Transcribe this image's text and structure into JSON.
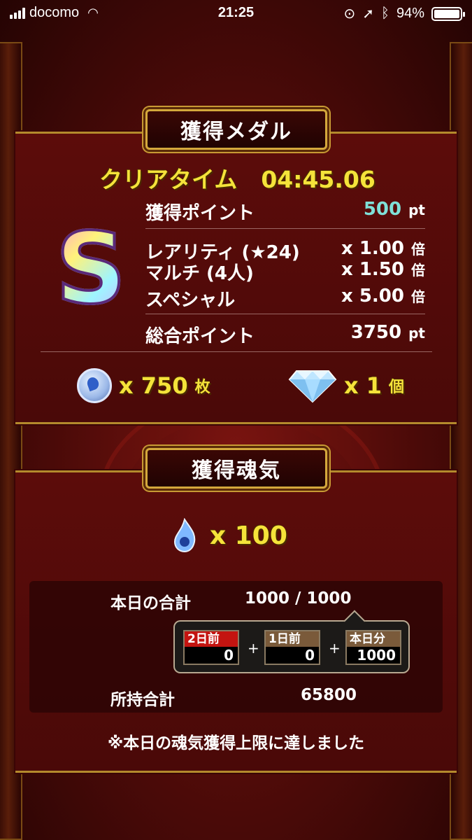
{
  "status_bar": {
    "carrier": "docomo",
    "time": "21:25",
    "battery": "94%"
  },
  "medal_panel": {
    "title": "獲得メダル",
    "clear_time_label": "クリアタイム",
    "clear_time_value": "04:45.06",
    "rank": "S",
    "earned_points_label": "獲得ポイント",
    "earned_points_value": "500",
    "pt_unit": "pt",
    "multipliers": [
      {
        "label": "レアリティ (★24)",
        "value": "x 1.00",
        "unit": "倍"
      },
      {
        "label": "マルチ (4人)",
        "value": "x 1.50",
        "unit": "倍"
      },
      {
        "label": "スペシャル",
        "value": "x 5.00",
        "unit": "倍"
      }
    ],
    "total_points_label": "総合ポイント",
    "total_points_value": "3750",
    "medal_reward": "x 750",
    "medal_unit": "枚",
    "gem_reward": "x 1",
    "gem_unit": "個"
  },
  "soul_panel": {
    "title": "獲得魂気",
    "soul_reward": "x 100",
    "today_total_label": "本日の合計",
    "today_total_value": "1000 / 1000",
    "days": [
      {
        "label": "2日前",
        "value": "0"
      },
      {
        "label": "1日前",
        "value": "0"
      },
      {
        "label": "本日分",
        "value": "1000"
      }
    ],
    "plus": "+",
    "owned_total_label": "所持合計",
    "owned_total_value": "65800",
    "note": "※本日の魂気獲得上限に達しました"
  },
  "colors": {
    "accent_yellow": "#f5e33a",
    "teal_points": "#7fe0d8",
    "gold_border": "#d4a83c",
    "red_day_label": "#c41410",
    "brown_day_label": "#7a5a3a"
  }
}
